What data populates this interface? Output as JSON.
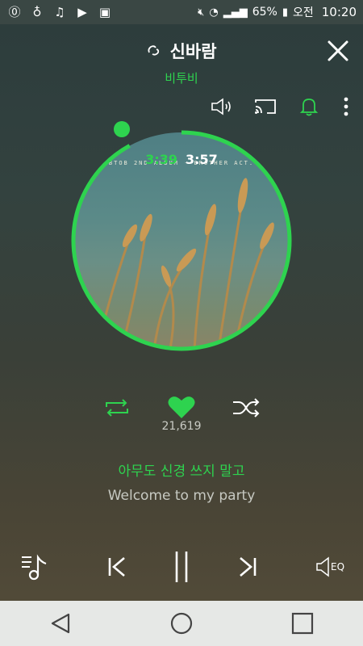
{
  "status_bar": {
    "battery": "65%",
    "period": "오전",
    "time": "10:20"
  },
  "header": {
    "song_title": "신바람",
    "artist": "비투비"
  },
  "album": {
    "caption": "BTOB 2ND ALBUM · BROTHER ACT."
  },
  "playback": {
    "elapsed": "3:39",
    "total": "3:57",
    "progress_fraction": 0.92
  },
  "like": {
    "count": "21,619"
  },
  "lyrics": {
    "current": "아무도 신경 쓰지 말고",
    "next": "Welcome to my party"
  },
  "player": {
    "eq_label": "EQ"
  },
  "colors": {
    "accent": "#2ed34f",
    "background_top": "#2c3c3c",
    "background_bottom": "#514a38",
    "nav_bar": "#e6e8e6"
  },
  "icons": [
    "notification-app-icon",
    "music-app-icon",
    "music-note-icon",
    "youtube-icon",
    "gallery-icon",
    "mute-icon",
    "wifi-icon",
    "signal-icon",
    "battery-icon",
    "link-icon",
    "close-icon",
    "speaker-icon",
    "cast-icon",
    "bell-icon",
    "more-icon",
    "repeat-icon",
    "heart-icon",
    "shuffle-icon",
    "playlist-icon",
    "previous-icon",
    "pause-icon",
    "next-icon",
    "eq-icon",
    "back-icon",
    "home-icon",
    "recents-icon"
  ]
}
